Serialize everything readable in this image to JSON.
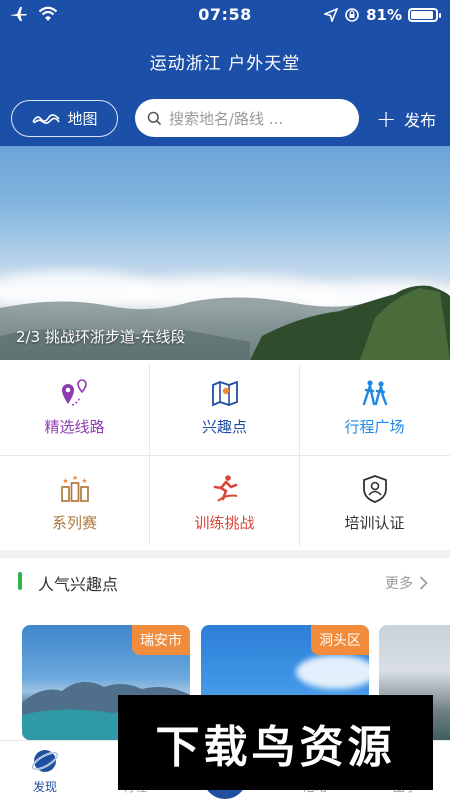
{
  "status_bar": {
    "time": "07:58",
    "battery": "81%"
  },
  "header": {
    "title": "运动浙江 户外天堂",
    "map_label": "地图",
    "search_placeholder": "搜索地名/路线 ...",
    "publish_label": "发布"
  },
  "banner": {
    "caption": "2/3 挑战环浙步道-东线段"
  },
  "grid": {
    "items": [
      {
        "label": "精选线路",
        "color": "#8e3bb3",
        "icon": "route-pin-icon"
      },
      {
        "label": "兴趣点",
        "color": "#1f4fa0",
        "icon": "map-icon"
      },
      {
        "label": "行程广场",
        "color": "#1e88e5",
        "icon": "hikers-icon"
      },
      {
        "label": "系列赛",
        "color": "#b07a3f",
        "icon": "trophy-series-icon"
      },
      {
        "label": "训练挑战",
        "color": "#d9463a",
        "icon": "runner-icon"
      },
      {
        "label": "培训认证",
        "color": "#333333",
        "icon": "certified-user-icon"
      }
    ]
  },
  "section": {
    "title": "人气兴趣点",
    "more_label": "更多"
  },
  "cards": [
    {
      "tag": "瑞安市"
    },
    {
      "tag": "洞头区"
    }
  ],
  "tabbar": {
    "tabs": [
      {
        "label": "发现",
        "active": true,
        "color": "#1f4fa0"
      },
      {
        "label": "行程",
        "active": false
      },
      {
        "label": "",
        "active": false
      },
      {
        "label": "活动",
        "active": false
      },
      {
        "label": "圈子",
        "active": false
      }
    ]
  },
  "watermark": {
    "text": "下载鸟资源"
  }
}
